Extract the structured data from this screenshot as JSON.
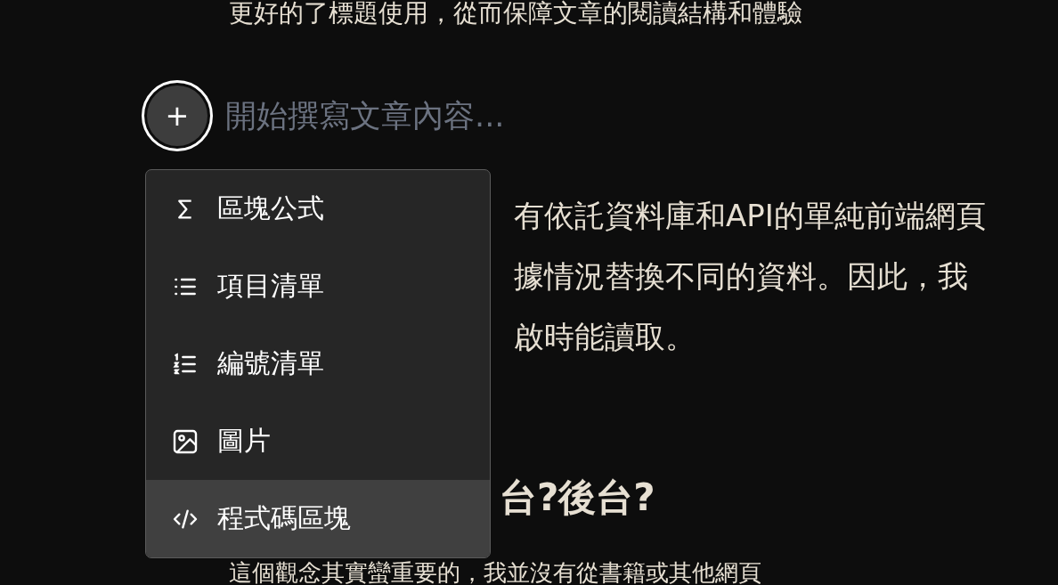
{
  "article_top_line": "更好的了標題使用，從而保障文章的閱讀結構和體驗",
  "editor": {
    "add_button": "+",
    "placeholder": "開始撰寫文章內容..."
  },
  "block_menu": {
    "items": [
      {
        "kind": "formula",
        "label": "區塊公式",
        "selected": false
      },
      {
        "kind": "bullet-list",
        "label": "項目清單",
        "selected": false
      },
      {
        "kind": "numbered-list",
        "label": "編號清單",
        "selected": false
      },
      {
        "kind": "image",
        "label": "圖片",
        "selected": false
      },
      {
        "kind": "code",
        "label": "程式碼區塊",
        "selected": true
      }
    ]
  },
  "paragraph_lines": [
    "有依託資料庫和API的單純前端網頁",
    "據情況替換不同的資料。因此，我",
    "啟時能讀取。"
  ],
  "heading": "台?後台?",
  "article_bottom_line": "這個觀念其實蠻重要的，我並沒有從書籍或其他網頁"
}
